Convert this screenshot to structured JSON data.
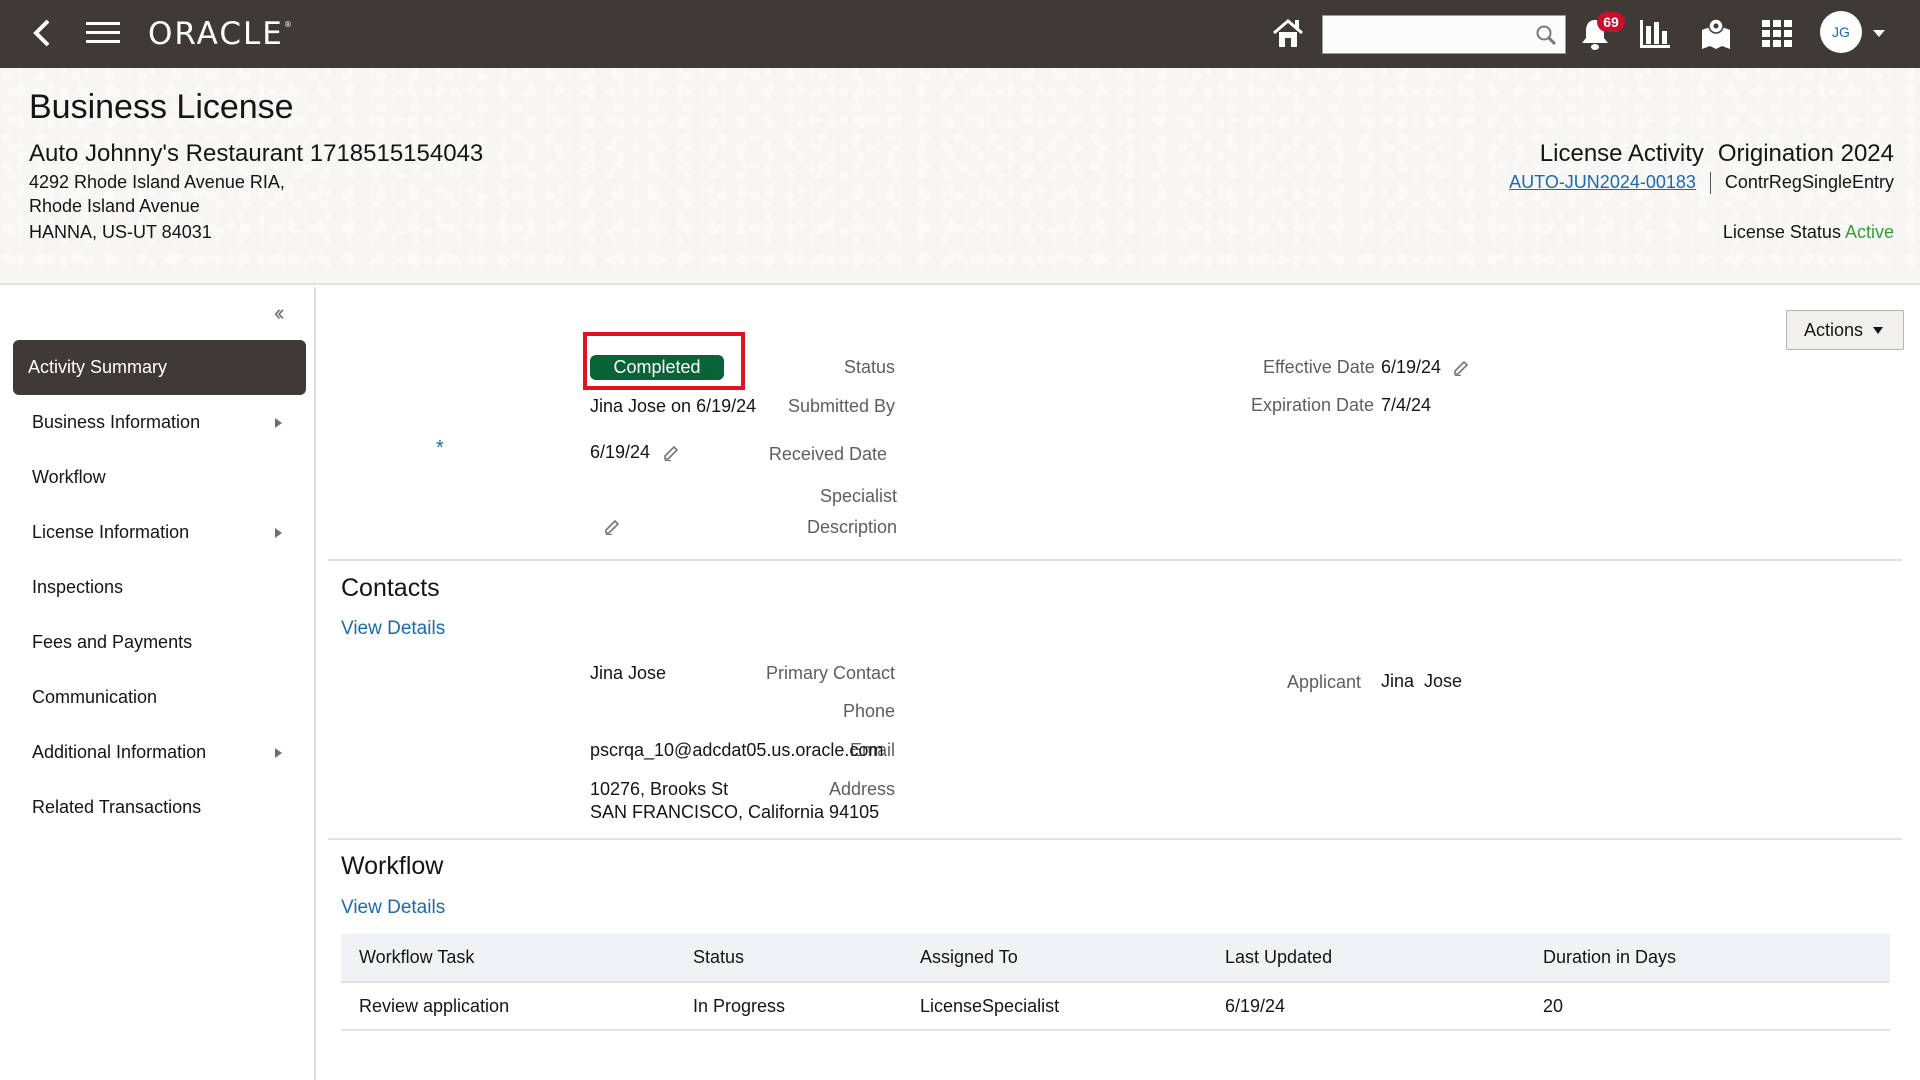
{
  "topbar": {
    "back_icon": "back-chevron-icon",
    "menu_icon": "hamburger-menu-icon",
    "logo": "ORACLE",
    "logo_mark": "®",
    "home_icon": "home-icon",
    "search": {
      "value": "",
      "placeholder": "",
      "icon": "search-icon"
    },
    "notifications": {
      "icon": "bell-icon",
      "count": "69"
    },
    "analytics_icon": "bar-chart-icon",
    "map_icon": "map-pin-icon",
    "apps_icon": "grid-icon",
    "user": {
      "initials": "JG",
      "menu_icon": "caret-down-icon"
    }
  },
  "banner": {
    "title": "Business License",
    "business_name": "Auto Johnny's Restaurant 1718515154043",
    "address_lines": [
      "4292 Rhode Island Avenue RIA,",
      "Rhode Island Avenue",
      "HANNA, US-UT 84031"
    ],
    "activity_type": "License Activity",
    "activity_subtype": "Origination 2024",
    "record_id": "AUTO-JUN2024-00183",
    "record_type": "ContrRegSingleEntry",
    "license_status_label": "License Status",
    "license_status_value": "Active",
    "license_status_color": "#2f9f3b"
  },
  "sidebar": {
    "collapse_icon": "double-chevron-left-icon",
    "items": [
      {
        "label": "Activity Summary",
        "active": true,
        "has_submenu": false
      },
      {
        "label": "Business Information",
        "active": false,
        "has_submenu": true
      },
      {
        "label": "Workflow",
        "active": false,
        "has_submenu": false
      },
      {
        "label": "License Information",
        "active": false,
        "has_submenu": true
      },
      {
        "label": "Inspections",
        "active": false,
        "has_submenu": false
      },
      {
        "label": "Fees and Payments",
        "active": false,
        "has_submenu": false
      },
      {
        "label": "Communication",
        "active": false,
        "has_submenu": false
      },
      {
        "label": "Additional Information",
        "active": false,
        "has_submenu": true
      },
      {
        "label": "Related Transactions",
        "active": false,
        "has_submenu": false
      }
    ]
  },
  "main": {
    "actions_label": "Actions",
    "summary": {
      "status_label": "Status",
      "status_value": "Completed",
      "status_color": "#0a6337",
      "submitted_by_label": "Submitted By",
      "submitted_by_value": "Jina Jose on 6/19/24",
      "received_date_label": "Received Date",
      "received_date_required": "*",
      "received_date_value": "6/19/24",
      "specialist_label": "Specialist",
      "specialist_value": "",
      "description_label": "Description",
      "description_value": "",
      "effective_date_label": "Effective Date",
      "effective_date_value": "6/19/24",
      "expiration_date_label": "Expiration Date",
      "expiration_date_value": "7/4/24"
    },
    "contacts": {
      "title": "Contacts",
      "view_details": "View Details",
      "primary_contact_label": "Primary Contact",
      "primary_contact_value": "Jina Jose",
      "phone_label": "Phone",
      "phone_value": "",
      "email_label": "Email",
      "email_value": "pscrqa_10@adcdat05.us.oracle.com",
      "address_label": "Address",
      "address_line1": "10276, Brooks St",
      "address_line2": "SAN FRANCISCO, California 94105",
      "applicant_label": "Applicant",
      "applicant_value": "Jina  Jose"
    },
    "workflow": {
      "title": "Workflow",
      "view_details": "View Details",
      "columns": [
        "Workflow Task",
        "Status",
        "Assigned To",
        "Last Updated",
        "Duration in Days"
      ],
      "rows": [
        [
          "Review application",
          "In Progress",
          "LicenseSpecialist",
          "6/19/24",
          "20"
        ]
      ]
    }
  }
}
